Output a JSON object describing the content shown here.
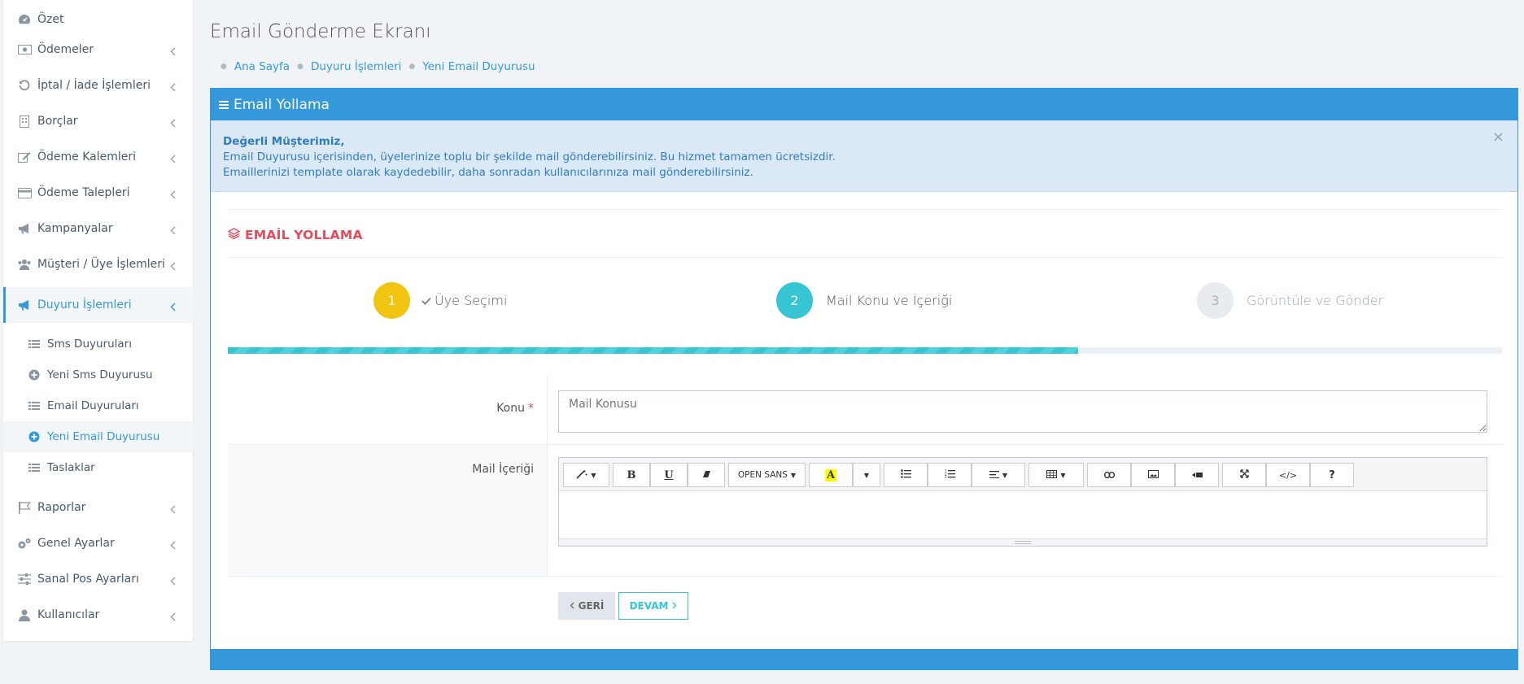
{
  "sidebar": {
    "items": [
      {
        "label": "Özet",
        "icon": "dashboard-icon"
      },
      {
        "label": "Ödemeler",
        "icon": "money-icon"
      },
      {
        "label": "İptal / İade İşlemleri",
        "icon": "undo-icon"
      },
      {
        "label": "Borçlar",
        "icon": "building-icon"
      },
      {
        "label": "Ödeme Kalemleri",
        "icon": "edit-icon"
      },
      {
        "label": "Ödeme Talepleri",
        "icon": "credit-card-icon"
      },
      {
        "label": "Kampanyalar",
        "icon": "bullhorn-icon"
      },
      {
        "label": "Müşteri / Üye İşlemleri",
        "icon": "users-icon"
      },
      {
        "label": "Duyuru İşlemleri",
        "icon": "bullhorn-icon"
      }
    ],
    "submenu": [
      {
        "label": "Sms Duyuruları",
        "icon": "list-icon"
      },
      {
        "label": "Yeni Sms Duyurusu",
        "icon": "plus-circle-icon"
      },
      {
        "label": "Email Duyuruları",
        "icon": "list-icon"
      },
      {
        "label": "Yeni Email Duyurusu",
        "icon": "plus-circle-icon"
      },
      {
        "label": "Taslaklar",
        "icon": "list-icon"
      }
    ],
    "items_after": [
      {
        "label": "Raporlar",
        "icon": "flag-icon"
      },
      {
        "label": "Genel Ayarlar",
        "icon": "gears-icon"
      },
      {
        "label": "Sanal Pos Ayarları",
        "icon": "sliders-icon"
      },
      {
        "label": "Kullanıcılar",
        "icon": "user-icon"
      }
    ]
  },
  "page": {
    "title": "Email Gönderme Ekranı",
    "breadcrumb": [
      "Ana Sayfa",
      "Duyuru İşlemleri",
      "Yeni Email Duyurusu"
    ]
  },
  "panel": {
    "title": "Email Yollama",
    "alert": {
      "heading": "Değerli Müşterimiz,",
      "line1": "Email Duyurusu içerisinden, üyelerinize toplu bir şekilde mail gönderebilirsiniz. Bu hizmet tamamen ücretsizdir.",
      "line2": "Emaillerinizi template olarak kaydedebilir, daha sonradan kullanıcılarınıza mail gönderebilirsiniz.",
      "close": "×"
    },
    "section_title": "EMAİL YOLLAMA",
    "steps": [
      {
        "num": "1",
        "label": "Üye Seçimi"
      },
      {
        "num": "2",
        "label": "Mail Konu ve İçeriği"
      },
      {
        "num": "3",
        "label": "Görüntüle ve Gönder"
      }
    ],
    "progress_fraction": 0.667,
    "form": {
      "subject_label": "Konu",
      "required_mark": "*",
      "subject_placeholder": "Mail Konusu",
      "content_label": "Mail İçeriği"
    },
    "toolbar": {
      "font": "OPEN SANS",
      "bold": "B",
      "underline": "U",
      "highlight": "A",
      "help": "?",
      "code": "</>"
    },
    "buttons": {
      "back": "GERİ",
      "next": "DEVAM"
    }
  },
  "colors": {
    "primary": "#3498db",
    "step_done": "#f1c40f",
    "step_active": "#36c6d3",
    "step_pending": "#e9ecef",
    "section_title": "#e84c5a"
  }
}
